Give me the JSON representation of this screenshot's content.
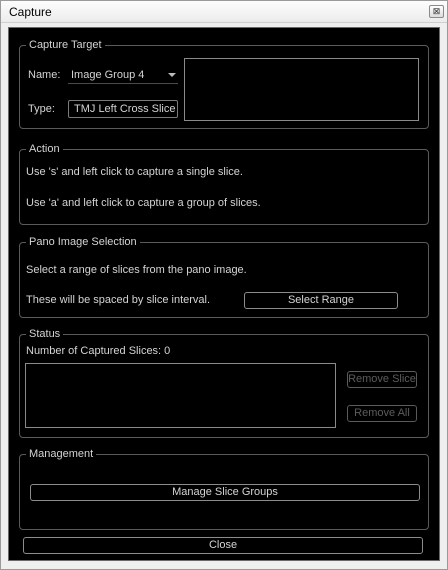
{
  "window": {
    "title": "Capture",
    "close_glyph": "⊠"
  },
  "capture_target": {
    "legend": "Capture Target",
    "name_label": "Name:",
    "name_value": "Image Group 4",
    "type_label": "Type:",
    "type_value": "TMJ Left Cross Slice"
  },
  "action": {
    "legend": "Action",
    "line1": "Use 's' and left click to capture a single slice.",
    "line2": "Use 'a' and left click to capture a group of slices."
  },
  "pano": {
    "legend": "Pano Image Selection",
    "line1": "Select a range of slices from the pano image.",
    "line2": "These will be spaced by slice interval.",
    "select_range_label": "Select Range"
  },
  "status": {
    "legend": "Status",
    "captured_label": "Number of Captured Slices: 0",
    "remove_slice_label": "Remove Slice",
    "remove_all_label": "Remove All"
  },
  "management": {
    "legend": "Management",
    "manage_label": "Manage Slice Groups"
  },
  "footer": {
    "close_label": "Close"
  },
  "icons": {
    "name_combo": "chevron-down-icon",
    "close": "close-icon"
  }
}
